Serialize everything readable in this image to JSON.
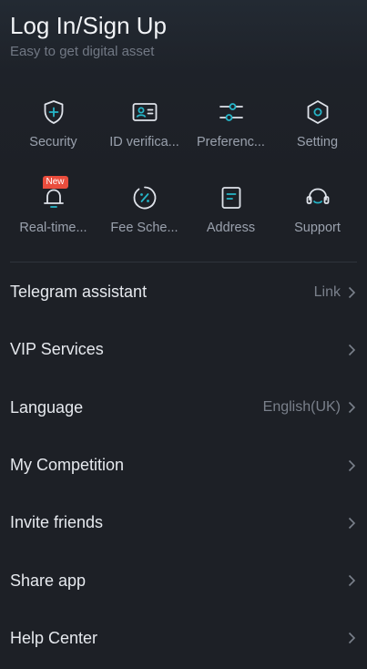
{
  "header": {
    "title": "Log In/Sign Up",
    "subtitle": "Easy to get digital asset"
  },
  "accent_color": "#26b6c9",
  "badge_color": "#ea4d3d",
  "shortcuts": [
    {
      "label": "Security",
      "icon": "shield-plus-icon"
    },
    {
      "label": "ID verifica...",
      "icon": "id-card-icon"
    },
    {
      "label": "Preferenc...",
      "icon": "sliders-icon"
    },
    {
      "label": "Setting",
      "icon": "hexagon-gear-icon"
    },
    {
      "label": "Real-time...",
      "icon": "bell-icon",
      "badge": "New"
    },
    {
      "label": "Fee Sche...",
      "icon": "percent-circle-icon"
    },
    {
      "label": "Address",
      "icon": "document-icon"
    },
    {
      "label": "Support",
      "icon": "headset-icon"
    }
  ],
  "menu": [
    {
      "label": "Telegram assistant",
      "value": "Link"
    },
    {
      "label": "VIP Services",
      "value": ""
    },
    {
      "label": "Language",
      "value": "English(UK)"
    },
    {
      "label": "My Competition",
      "value": ""
    },
    {
      "label": "Invite friends",
      "value": ""
    },
    {
      "label": "Share app",
      "value": ""
    },
    {
      "label": "Help Center",
      "value": ""
    }
  ]
}
